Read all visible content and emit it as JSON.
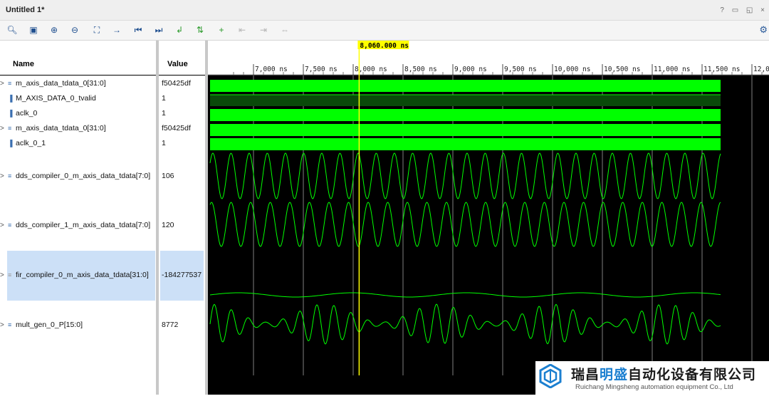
{
  "window": {
    "title": "Untitled 1*",
    "controls": "? ▭ ◱ ×"
  },
  "toolbar": {
    "icons": [
      "search-icon",
      "save-icon",
      "zoom-in-icon",
      "zoom-out-icon",
      "zoom-fit-icon",
      "cursor-icon",
      "go-first-icon",
      "go-last-icon",
      "add-marker-icon",
      "swap-icon",
      "add-icon",
      "prev-edge-icon",
      "next-edge-icon",
      "range-icon"
    ],
    "settings": "settings-icon"
  },
  "columns": {
    "name": "Name",
    "value": "Value"
  },
  "signals": [
    {
      "name": "m_axis_data_tdata_0[31:0]",
      "value": "f50425df",
      "expandable": true,
      "icon": "bus-icon"
    },
    {
      "name": "M_AXIS_DATA_0_tvalid",
      "value": "1",
      "expandable": false,
      "icon": "wire-icon"
    },
    {
      "name": "aclk_0",
      "value": "1",
      "expandable": false,
      "icon": "wire-icon"
    },
    {
      "name": "m_axis_data_tdata_0[31:0]",
      "value": "f50425df",
      "expandable": true,
      "icon": "bus-icon"
    },
    {
      "name": "aclk_0_1",
      "value": "1",
      "expandable": false,
      "icon": "wire-icon"
    },
    {
      "name": "dds_compiler_0_m_axis_data_tdata[7:0]",
      "value": "106",
      "expandable": true,
      "icon": "bus-icon"
    },
    {
      "name": "dds_compiler_1_m_axis_data_tdata[7:0]",
      "value": "120",
      "expandable": true,
      "icon": "bus-icon"
    },
    {
      "name": "fir_compiler_0_m_axis_data_tdata[31:0]",
      "value": "-184277537",
      "expandable": true,
      "icon": "bus-icon",
      "selected": true
    },
    {
      "name": "mult_gen_0_P[15:0]",
      "value": "8772",
      "expandable": true,
      "icon": "bus-icon"
    }
  ],
  "cursor": {
    "label": "8,060.000 ns",
    "time_ns": 8060
  },
  "timeline": {
    "ticks": [
      "7,000 ns",
      "7,500 ns",
      "8,000 ns",
      "8,500 ns",
      "9,000 ns",
      "9,500 ns",
      "10,000 ns",
      "10,500 ns",
      "11,000 ns",
      "11,500 ns",
      "12,0"
    ],
    "tick_values_ns": [
      7000,
      7500,
      8000,
      8500,
      9000,
      9500,
      10000,
      10500,
      11000,
      11500,
      12000
    ]
  },
  "colors": {
    "wave": "#00ff00",
    "cursor": "#ffff00",
    "background": "#000000",
    "selected": "#cce0f7"
  },
  "watermark": {
    "company_cn_a": "瑞昌",
    "company_cn_b": "明盛",
    "company_cn_c": "自动化设备有限公司",
    "company_en": "Ruichang Mingsheng automation equipment Co., Ltd"
  }
}
